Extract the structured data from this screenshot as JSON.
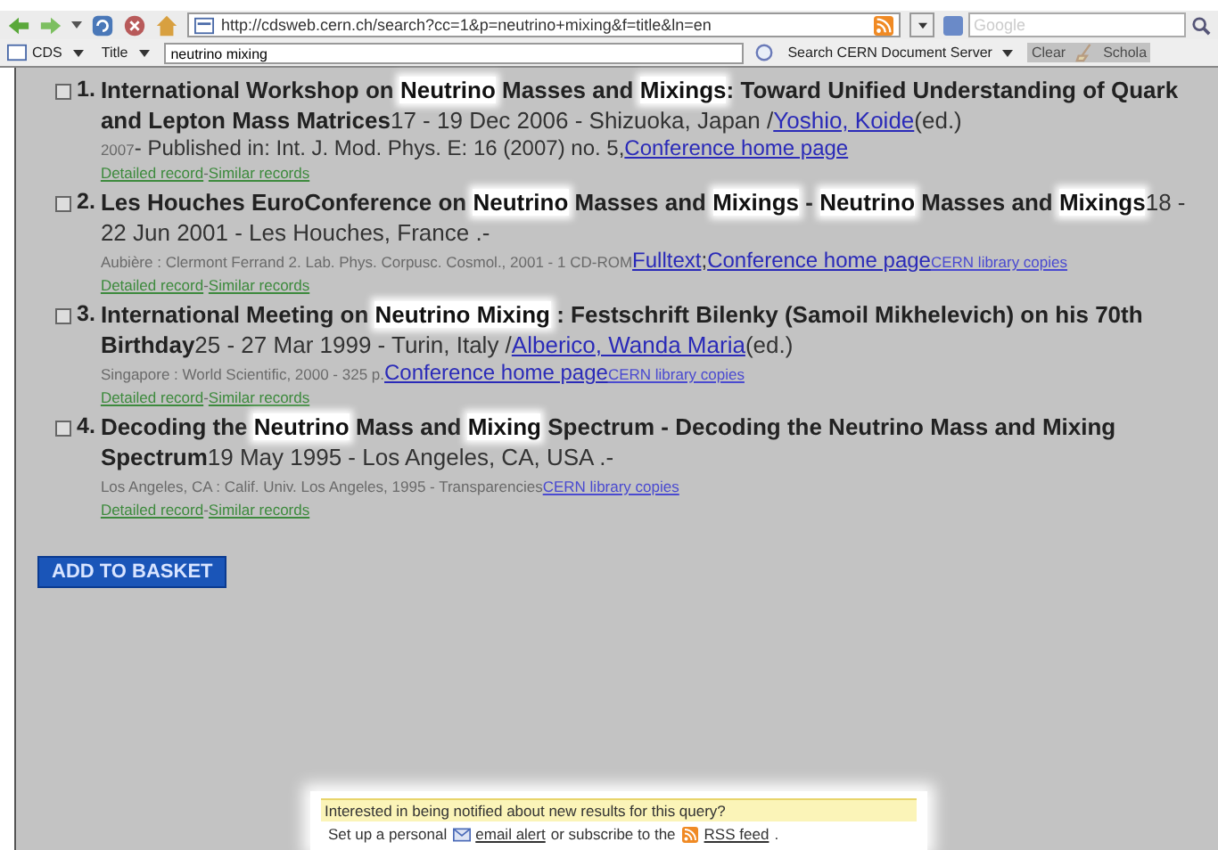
{
  "toolbar": {
    "url": "http://cdsweb.cern.ch/search?cc=1&p=neutrino+mixing&f=title&ln=en",
    "search_placeholder": "Google"
  },
  "search_bar": {
    "collection": "CDS",
    "field": "Title",
    "query": "neutrino mixing",
    "search_button": "Search CERN Document Server",
    "clear_button": "Clear",
    "extra": "Schola"
  },
  "results": [
    {
      "number": "1.",
      "checked": false,
      "title": [
        {
          "text": "International Workshop on ",
          "highlight": false
        },
        {
          "text": "Neutrino",
          "highlight": true
        },
        {
          "text": " Masses and ",
          "highlight": false
        },
        {
          "text": "Mixings",
          "highlight": true
        },
        {
          "text": ": Toward Unified Understanding of Quark and Lepton Mass Matrices",
          "highlight": false
        }
      ],
      "details": [
        {
          "kind": "plain",
          "text": "17 - 19 Dec 2006  - Shizuoka, Japan  /"
        },
        {
          "kind": "link",
          "text": "Yoshio, Koide"
        },
        {
          "kind": "plain",
          "text": "(ed.)"
        }
      ],
      "source": [
        {
          "kind": "small",
          "text": "2007"
        },
        {
          "kind": "plain",
          "text": "- Published in: Int. J. Mod. Phys. E: 16 (2007) no. 5,"
        },
        {
          "kind": "link",
          "text": "Conference home page"
        }
      ],
      "record_links": [
        {
          "kind": "green",
          "text": "Detailed record"
        },
        {
          "kind": "sep",
          "text": "-"
        },
        {
          "kind": "green",
          "text": "Similar records"
        }
      ]
    },
    {
      "number": "2.",
      "checked": false,
      "title": [
        {
          "text": "Les Houches EuroConference on ",
          "highlight": false
        },
        {
          "text": "Neutrino",
          "highlight": true
        },
        {
          "text": " Masses and ",
          "highlight": false
        },
        {
          "text": "Mixings",
          "highlight": true
        },
        {
          "text": " - ",
          "highlight": false
        },
        {
          "text": "Neutrino",
          "highlight": true
        },
        {
          "text": " Masses and ",
          "highlight": false
        },
        {
          "text": "Mixings",
          "highlight": true
        }
      ],
      "details": [
        {
          "kind": "plain",
          "text": "18 - 22 Jun 2001  - Les Houches, France  .-"
        }
      ],
      "source": [
        {
          "kind": "small",
          "text": "Aubière : Clermont Ferrand 2. Lab. Phys. Corpusc. Cosmol., 2001 - 1 CD-ROM"
        },
        {
          "kind": "link",
          "text": "Fulltext"
        },
        {
          "kind": "plain",
          "text": ";"
        },
        {
          "kind": "link",
          "text": "Conference home page"
        },
        {
          "kind": "small-link",
          "text": "CERN library copies"
        }
      ],
      "record_links": [
        {
          "kind": "green",
          "text": "Detailed record"
        },
        {
          "kind": "sep",
          "text": "-"
        },
        {
          "kind": "green",
          "text": "Similar records"
        }
      ]
    },
    {
      "number": "3.",
      "checked": false,
      "title": [
        {
          "text": "International Meeting on ",
          "highlight": false
        },
        {
          "text": "Neutrino Mixing",
          "highlight": true
        },
        {
          "text": " : Festschrift Bilenky (Samoil Mikhelevich) on his 70th Birthday",
          "highlight": false
        }
      ],
      "details": [
        {
          "kind": "plain",
          "text": "25 - 27 Mar 1999  - Turin, Italy  /"
        },
        {
          "kind": "link",
          "text": "Alberico, Wanda Maria"
        },
        {
          "kind": "plain",
          "text": "(ed.)"
        }
      ],
      "source": [
        {
          "kind": "small",
          "text": "Singapore : World Scientific, 2000 - 325 p."
        },
        {
          "kind": "link",
          "text": "Conference home page"
        },
        {
          "kind": "small-link",
          "text": "CERN library copies"
        }
      ],
      "record_links": [
        {
          "kind": "green",
          "text": "Detailed record"
        },
        {
          "kind": "sep",
          "text": "-"
        },
        {
          "kind": "green",
          "text": "Similar records"
        }
      ]
    },
    {
      "number": "4.",
      "checked": false,
      "title": [
        {
          "text": "Decoding the ",
          "highlight": false
        },
        {
          "text": "Neutrino",
          "highlight": true
        },
        {
          "text": " Mass and ",
          "highlight": false
        },
        {
          "text": "Mixing",
          "highlight": true
        },
        {
          "text": " Spectrum - Decoding the Neutrino Mass and Mixing Spectrum",
          "highlight": false
        }
      ],
      "details": [
        {
          "kind": "plain",
          "text": "19 May 1995  - Los Angeles, CA, USA  .-"
        }
      ],
      "source": [
        {
          "kind": "small",
          "text": "Los Angeles, CA : Calif. Univ. Los Angeles, 1995 - Transparencies"
        },
        {
          "kind": "small-link",
          "text": "CERN library copies"
        }
      ],
      "record_links": [
        {
          "kind": "green",
          "text": "Detailed record"
        },
        {
          "kind": "sep",
          "text": "-"
        },
        {
          "kind": "green",
          "text": "Similar records"
        }
      ]
    }
  ],
  "basket_button": "ADD TO BASKET",
  "notice": {
    "question": "Interested in being notified about new results for this query?",
    "parts": [
      {
        "kind": "plain",
        "text": "Set up a personal"
      },
      {
        "kind": "mail-icon"
      },
      {
        "kind": "link",
        "text": "email alert"
      },
      {
        "kind": "plain",
        "text": "or subscribe to the"
      },
      {
        "kind": "rss-icon"
      },
      {
        "kind": "link",
        "text": "RSS feed"
      },
      {
        "kind": "plain",
        "text": "."
      }
    ]
  }
}
